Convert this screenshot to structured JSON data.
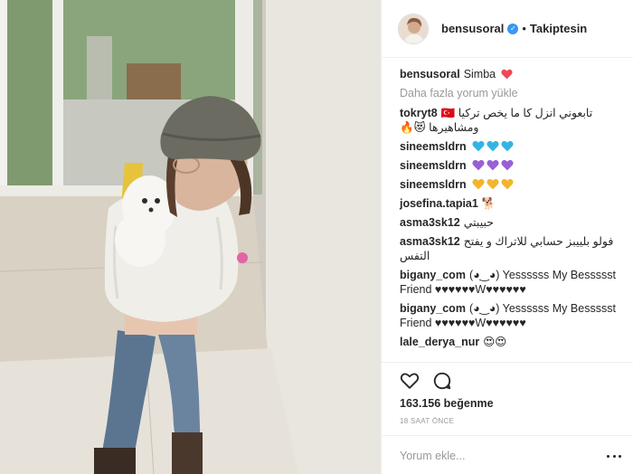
{
  "post": {
    "image_alt": "Woman in a grey bucket hat and white fleece jacket holding a small white puppy in a hallway",
    "username": "bensusoral",
    "separator": "•",
    "follow_label": "Takiptesin",
    "caption_text": "Simba",
    "load_more_label": "Daha fazla yorum yükle"
  },
  "comments": [
    {
      "user": "tokryt8",
      "text": "تابعوني انزل كا ما يخص تركيا 🇹🇷 ومشاهيرها 😻🔥"
    },
    {
      "user": "sineemsldrn",
      "text": "",
      "hearts": [
        "#34b4e4",
        "#34b4e4",
        "#34b4e4"
      ]
    },
    {
      "user": "sineemsldrn",
      "text": "",
      "hearts": [
        "#9a5fd6",
        "#9a5fd6",
        "#9a5fd6"
      ]
    },
    {
      "user": "sineemsldrn",
      "text": "",
      "hearts": [
        "#f3b52c",
        "#f3b52c",
        "#f3b52c"
      ]
    },
    {
      "user": "josefina.tapia1",
      "text": "🐕"
    },
    {
      "user": "asma3sk12",
      "text": "حبيبتي"
    },
    {
      "user": "asma3sk12",
      "text": "فولو بلييبز حسابي للاتراك و يفتح التفس"
    },
    {
      "user": "bigany_com",
      "text": "(◕‿◕) Yessssss My Bessssst Friend ♥♥♥♥♥♥W♥♥♥♥♥♥"
    },
    {
      "user": "bigany_com",
      "text": "(◕‿◕) Yessssss My Bessssst Friend ♥♥♥♥♥♥W♥♥♥♥♥♥"
    },
    {
      "user": "lale_derya_nur",
      "text": "😍😍"
    }
  ],
  "actions": {
    "like_icon": "heart-outline-icon",
    "comment_icon": "comment-bubble-icon",
    "likes_count": "163.156",
    "likes_label": "beğenme",
    "timestamp": "18 SAAT ÖNCE",
    "comment_placeholder": "Yorum ekle...",
    "more_icon": "ellipsis-icon"
  },
  "colors": {
    "verified_badge": "#3897f0",
    "caption_heart": "#ed4956",
    "muted_text": "#999999",
    "divider": "#efefef"
  }
}
